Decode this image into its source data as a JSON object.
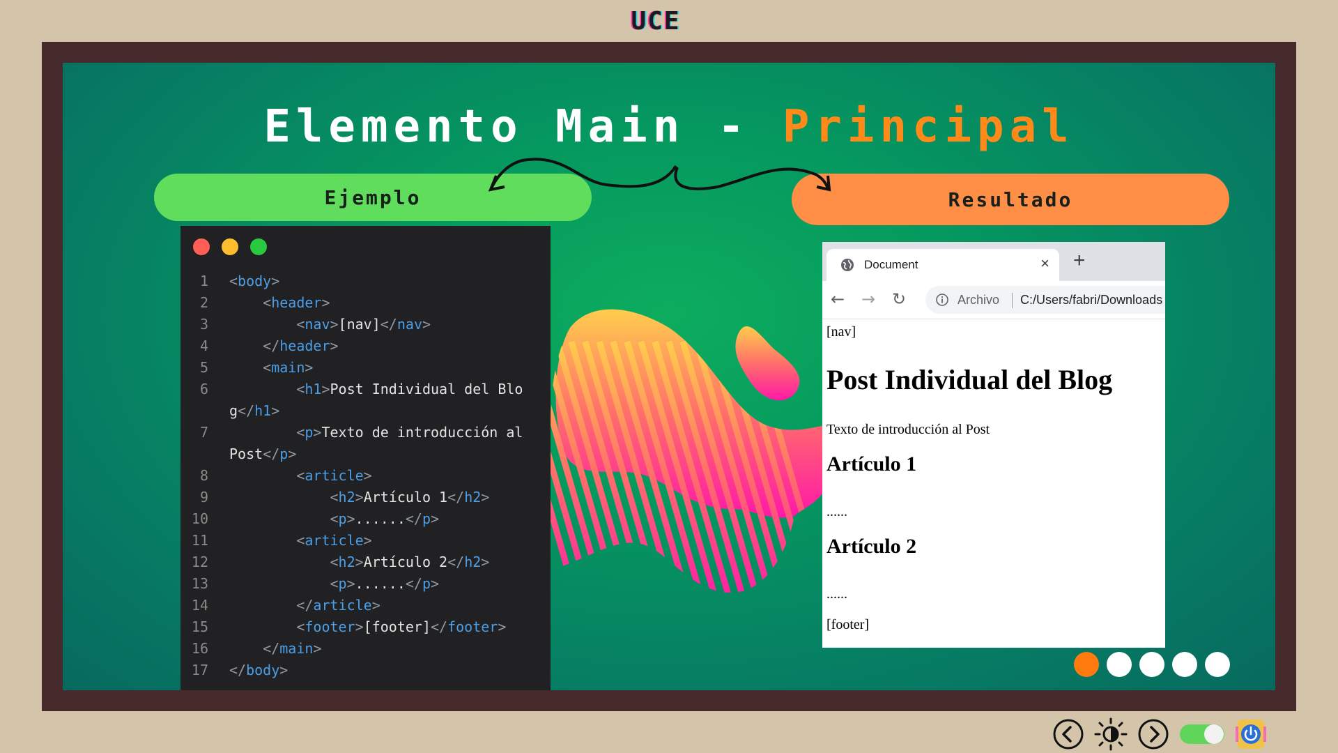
{
  "brand": "UCE",
  "slide": {
    "title_main": "Elemento Main - ",
    "title_accent": "Principal",
    "left_label": "Ejemplo",
    "right_label": "Resultado"
  },
  "code_lines": [
    {
      "n": "1",
      "indent": "",
      "parts": [
        [
          "br",
          "<"
        ],
        [
          "tg",
          "body"
        ],
        [
          "br",
          ">"
        ]
      ]
    },
    {
      "n": "2",
      "indent": "    ",
      "parts": [
        [
          "br",
          "<"
        ],
        [
          "tg",
          "header"
        ],
        [
          "br",
          ">"
        ]
      ]
    },
    {
      "n": "3",
      "indent": "        ",
      "parts": [
        [
          "br",
          "<"
        ],
        [
          "tg",
          "nav"
        ],
        [
          "br",
          ">"
        ],
        [
          "tx",
          "[nav]"
        ],
        [
          "br",
          "</"
        ],
        [
          "tg",
          "nav"
        ],
        [
          "br",
          ">"
        ]
      ]
    },
    {
      "n": "4",
      "indent": "    ",
      "parts": [
        [
          "br",
          "</"
        ],
        [
          "tg",
          "header"
        ],
        [
          "br",
          ">"
        ]
      ]
    },
    {
      "n": "5",
      "indent": "    ",
      "parts": [
        [
          "br",
          "<"
        ],
        [
          "tg",
          "main"
        ],
        [
          "br",
          ">"
        ]
      ]
    },
    {
      "n": "6",
      "indent": "        ",
      "parts": [
        [
          "br",
          "<"
        ],
        [
          "tg",
          "h1"
        ],
        [
          "br",
          ">"
        ],
        [
          "tx",
          "Post Individual del Blo"
        ]
      ]
    },
    {
      "n": "",
      "indent": "",
      "parts": [
        [
          "tx",
          "g"
        ],
        [
          "br",
          "</"
        ],
        [
          "tg",
          "h1"
        ],
        [
          "br",
          ">"
        ]
      ]
    },
    {
      "n": "7",
      "indent": "        ",
      "parts": [
        [
          "br",
          "<"
        ],
        [
          "tg",
          "p"
        ],
        [
          "br",
          ">"
        ],
        [
          "tx",
          "Texto de introducción al"
        ]
      ]
    },
    {
      "n": "",
      "indent": "",
      "parts": [
        [
          "tx",
          "Post"
        ],
        [
          "br",
          "</"
        ],
        [
          "tg",
          "p"
        ],
        [
          "br",
          ">"
        ]
      ]
    },
    {
      "n": "8",
      "indent": "        ",
      "parts": [
        [
          "br",
          "<"
        ],
        [
          "tg",
          "article"
        ],
        [
          "br",
          ">"
        ]
      ]
    },
    {
      "n": "9",
      "indent": "            ",
      "parts": [
        [
          "br",
          "<"
        ],
        [
          "tg",
          "h2"
        ],
        [
          "br",
          ">"
        ],
        [
          "tx",
          "Artículo 1"
        ],
        [
          "br",
          "</"
        ],
        [
          "tg",
          "h2"
        ],
        [
          "br",
          ">"
        ]
      ]
    },
    {
      "n": "10",
      "indent": "            ",
      "parts": [
        [
          "br",
          "<"
        ],
        [
          "tg",
          "p"
        ],
        [
          "br",
          ">"
        ],
        [
          "tx",
          "......"
        ],
        [
          "br",
          "</"
        ],
        [
          "tg",
          "p"
        ],
        [
          "br",
          ">"
        ]
      ]
    },
    {
      "n": "11",
      "indent": "        ",
      "parts": [
        [
          "br",
          "<"
        ],
        [
          "tg",
          "article"
        ],
        [
          "br",
          ">"
        ]
      ]
    },
    {
      "n": "12",
      "indent": "            ",
      "parts": [
        [
          "br",
          "<"
        ],
        [
          "tg",
          "h2"
        ],
        [
          "br",
          ">"
        ],
        [
          "tx",
          "Artículo 2"
        ],
        [
          "br",
          "</"
        ],
        [
          "tg",
          "h2"
        ],
        [
          "br",
          ">"
        ]
      ]
    },
    {
      "n": "13",
      "indent": "            ",
      "parts": [
        [
          "br",
          "<"
        ],
        [
          "tg",
          "p"
        ],
        [
          "br",
          ">"
        ],
        [
          "tx",
          "......"
        ],
        [
          "br",
          "</"
        ],
        [
          "tg",
          "p"
        ],
        [
          "br",
          ">"
        ]
      ]
    },
    {
      "n": "14",
      "indent": "        ",
      "parts": [
        [
          "br",
          "</"
        ],
        [
          "tg",
          "article"
        ],
        [
          "br",
          ">"
        ]
      ]
    },
    {
      "n": "15",
      "indent": "        ",
      "parts": [
        [
          "br",
          "<"
        ],
        [
          "tg",
          "footer"
        ],
        [
          "br",
          ">"
        ],
        [
          "tx",
          "[footer]"
        ],
        [
          "br",
          "</"
        ],
        [
          "tg",
          "footer"
        ],
        [
          "br",
          ">"
        ]
      ]
    },
    {
      "n": "16",
      "indent": "    ",
      "parts": [
        [
          "br",
          "</"
        ],
        [
          "tg",
          "main"
        ],
        [
          "br",
          ">"
        ]
      ]
    },
    {
      "n": "17",
      "indent": "",
      "parts": [
        [
          "br",
          "</"
        ],
        [
          "tg",
          "body"
        ],
        [
          "br",
          ">"
        ]
      ]
    }
  ],
  "browser": {
    "tab_title": "Document",
    "tab_close": "×",
    "new_tab": "+",
    "back": "←",
    "forward": "→",
    "reload": "↻",
    "url_label": "Archivo",
    "url": "C:/Users/fabri/Downloads",
    "page": {
      "nav": "[nav]",
      "h1": "Post Individual del Blog",
      "intro": "Texto de introducción al Post",
      "h2_1": "Artículo 1",
      "dots_1": "......",
      "h2_2": "Artículo 2",
      "dots_2": "......",
      "footer": "[footer]"
    }
  },
  "pager": {
    "count": 5,
    "active": 1
  },
  "controls": {
    "prev_icon": "chevron-left-circle-icon",
    "theme_icon": "brightness-icon",
    "next_icon": "chevron-right-circle-icon",
    "toggle_icon": "toggle-switch-icon",
    "power_icon": "power-icon"
  },
  "colors": {
    "accent_orange": "#ff8a1a",
    "pill_green": "#60dd5c",
    "pill_orange": "#ff8e47",
    "frame": "#472b2c",
    "background": "#d4c4aa"
  }
}
